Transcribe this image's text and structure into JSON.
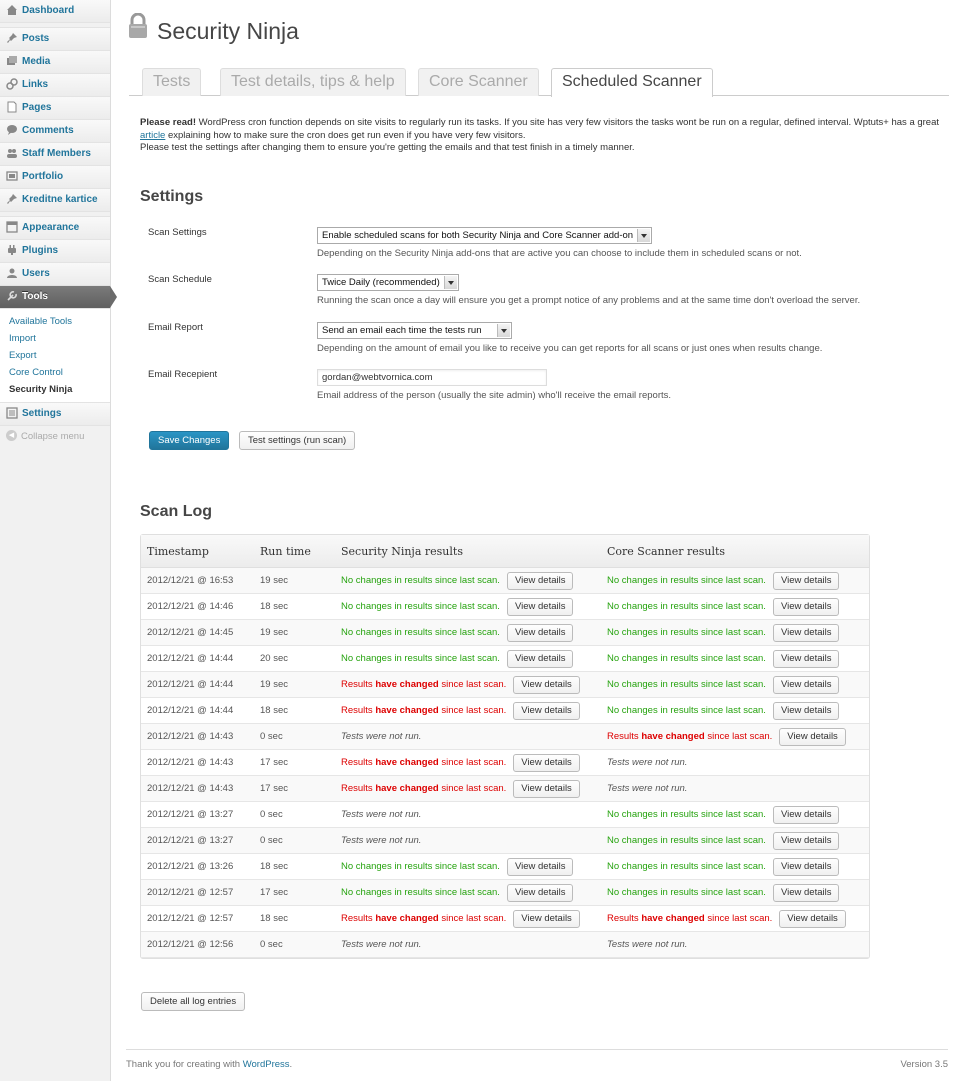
{
  "sidebar": {
    "items": [
      {
        "label": "Dashboard",
        "icon": "dashboard-icon"
      },
      {
        "label": "Posts",
        "icon": "pin-icon"
      },
      {
        "label": "Media",
        "icon": "media-icon"
      },
      {
        "label": "Links",
        "icon": "link-icon"
      },
      {
        "label": "Pages",
        "icon": "page-icon"
      },
      {
        "label": "Comments",
        "icon": "comment-icon"
      },
      {
        "label": "Staff Members",
        "icon": "people-icon"
      },
      {
        "label": "Portfolio",
        "icon": "portfolio-icon"
      },
      {
        "label": "Kreditne kartice",
        "icon": "pin-icon"
      },
      {
        "label": "Appearance",
        "icon": "appearance-icon"
      },
      {
        "label": "Plugins",
        "icon": "plugin-icon"
      },
      {
        "label": "Users",
        "icon": "users-icon"
      },
      {
        "label": "Tools",
        "icon": "tools-icon"
      },
      {
        "label": "Settings",
        "icon": "settings-icon"
      }
    ],
    "submenu": [
      "Available Tools",
      "Import",
      "Export",
      "Core Control",
      "Security Ninja"
    ],
    "collapse": "Collapse menu"
  },
  "page": {
    "title": "Security Ninja",
    "tabs": [
      "Tests",
      "Test details, tips & help",
      "Core Scanner",
      "Scheduled Scanner"
    ],
    "intro": {
      "bold": "Please read!",
      "text1": " WordPress cron function depends on site visits to regularly run its tasks. If you site has very few visitors the tasks wont be run on a regular, defined interval. Wptuts+ has a great ",
      "link": "article",
      "text2": " explaining how to make sure the cron does get run even if you have very few visitors.",
      "line2": "Please test the settings after changing them to ensure you're getting the emails and that test finish in a timely manner."
    }
  },
  "settings": {
    "heading": "Settings",
    "scan_settings": {
      "label": "Scan Settings",
      "value": "Enable scheduled scans for both Security Ninja and Core Scanner add-on",
      "desc": "Depending on the Security Ninja add-ons that are active you can choose to include them in scheduled scans or not."
    },
    "scan_schedule": {
      "label": "Scan Schedule",
      "value": "Twice Daily (recommended)",
      "desc": "Running the scan once a day will ensure you get a prompt notice of any problems and at the same time don't overload the server."
    },
    "email_report": {
      "label": "Email Report",
      "value": "Send an email each time the tests run",
      "desc": "Depending on the amount of email you like to receive you can get reports for all scans or just ones when results change."
    },
    "email_recipient": {
      "label": "Email Recepient",
      "value": "gordan@webtvornica.com",
      "desc": "Email address of the person (usually the site admin) who'll receive the email reports."
    },
    "save_label": "Save Changes",
    "test_label": "Test settings (run scan)"
  },
  "log": {
    "heading": "Scan Log",
    "headers": [
      "Timestamp",
      "Run time",
      "Security Ninja results",
      "Core Scanner results"
    ],
    "view_label": "View details",
    "status_text": {
      "ok": "No changes in results since last scan.",
      "changed_pre": "Results ",
      "changed_bold": "have changed",
      "changed_post": " since last scan.",
      "notrun": "Tests were not run."
    },
    "rows": [
      {
        "ts": "2012/12/21 @ 16:53",
        "rt": "19 sec",
        "sn": "ok",
        "cs": "ok"
      },
      {
        "ts": "2012/12/21 @ 14:46",
        "rt": "18 sec",
        "sn": "ok",
        "cs": "ok"
      },
      {
        "ts": "2012/12/21 @ 14:45",
        "rt": "19 sec",
        "sn": "ok",
        "cs": "ok"
      },
      {
        "ts": "2012/12/21 @ 14:44",
        "rt": "20 sec",
        "sn": "ok",
        "cs": "ok"
      },
      {
        "ts": "2012/12/21 @ 14:44",
        "rt": "19 sec",
        "sn": "changed",
        "cs": "ok"
      },
      {
        "ts": "2012/12/21 @ 14:44",
        "rt": "18 sec",
        "sn": "changed",
        "cs": "ok"
      },
      {
        "ts": "2012/12/21 @ 14:43",
        "rt": "0 sec",
        "sn": "notrun",
        "cs": "changed"
      },
      {
        "ts": "2012/12/21 @ 14:43",
        "rt": "17 sec",
        "sn": "changed",
        "cs": "notrun"
      },
      {
        "ts": "2012/12/21 @ 14:43",
        "rt": "17 sec",
        "sn": "changed",
        "cs": "notrun"
      },
      {
        "ts": "2012/12/21 @ 13:27",
        "rt": "0 sec",
        "sn": "notrun",
        "cs": "ok"
      },
      {
        "ts": "2012/12/21 @ 13:27",
        "rt": "0 sec",
        "sn": "notrun",
        "cs": "ok"
      },
      {
        "ts": "2012/12/21 @ 13:26",
        "rt": "18 sec",
        "sn": "ok",
        "cs": "ok"
      },
      {
        "ts": "2012/12/21 @ 12:57",
        "rt": "17 sec",
        "sn": "ok",
        "cs": "ok"
      },
      {
        "ts": "2012/12/21 @ 12:57",
        "rt": "18 sec",
        "sn": "changed",
        "cs": "changed"
      },
      {
        "ts": "2012/12/21 @ 12:56",
        "rt": "0 sec",
        "sn": "notrun",
        "cs": "notrun"
      }
    ],
    "delete_label": "Delete all log entries"
  },
  "footer": {
    "text": "Thank you for creating with ",
    "link": "WordPress",
    "end": ".",
    "version": "Version 3.5"
  },
  "colors": {
    "link": "#21759b",
    "ok": "#26a30f",
    "changed": "#dd0000",
    "primary": "#21759b"
  }
}
